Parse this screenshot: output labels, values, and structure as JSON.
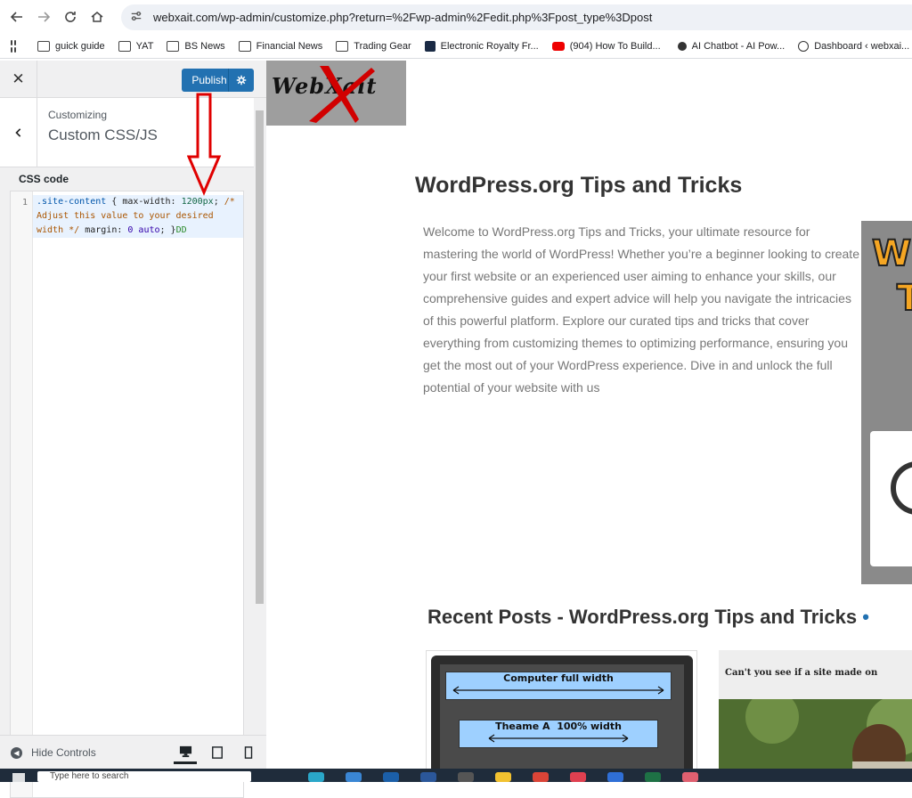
{
  "browser": {
    "url": "webxait.com/wp-admin/customize.php?return=%2Fwp-admin%2Fedit.php%3Fpost_type%3Dpost",
    "bookmarks": [
      {
        "label": "guick guide",
        "icon": "folder-icon"
      },
      {
        "label": "YAT",
        "icon": "folder-icon"
      },
      {
        "label": "BS News",
        "icon": "folder-icon"
      },
      {
        "label": "Financial News",
        "icon": "folder-icon"
      },
      {
        "label": "Trading Gear",
        "icon": "folder-icon"
      },
      {
        "label": "Electronic Royalty Fr...",
        "icon": "st-site-icon"
      },
      {
        "label": "(904) How To Build...",
        "icon": "youtube-icon"
      },
      {
        "label": "AI Chatbot - AI Pow...",
        "icon": "openai-icon"
      },
      {
        "label": "Dashboard ‹ webxai...",
        "icon": "wordpress-icon"
      }
    ]
  },
  "customizer": {
    "publish_label": "Publish",
    "customizing_label": "Customizing",
    "section_title": "Custom CSS/JS",
    "css_label": "CSS code",
    "line_number": "1",
    "code": {
      "selector": ".site-content",
      "brace_open": " { ",
      "prop1": "max-width",
      "colon": ": ",
      "value1": "1200px",
      "semi": "; ",
      "comment_start": "/*",
      "comment_body": "Adjust this value to your desired width",
      "comment_end": "*/",
      "prop2": "margin",
      "value2": "0 auto",
      "brace_close": "; }",
      "trailing": "DD"
    },
    "hide_controls_label": "Hide Controls"
  },
  "preview": {
    "logo_text": "WebXait",
    "site_title": "WordPress.org Tips and Tricks",
    "intro": "Welcome to WordPress.org Tips and Tricks, your ultimate resource for mastering the world of WordPress! Whether you’re a beginner looking to create your first website or an experienced user aiming to enhance your skills, our comprehensive guides and expert advice will help you navigate the intricacies of this powerful platform. Explore our curated tips and tricks that cover everything from customizing themes to optimizing performance, ensuring you get the most out of your WordPress experience. Dive in and unlock the full potential of your website with us",
    "recent_posts_title": "Recent Posts - WordPress.org Tips and Tricks",
    "recent_bullet": "•",
    "post1": {
      "line1": "Computer full width",
      "line2": "Theame A  100% width"
    },
    "post2": {
      "caption": "Can't you see if a site made on"
    }
  },
  "taskbar": {
    "search_placeholder": "Type here to search"
  },
  "colors": {
    "publish_blue": "#2271b1",
    "annotation_red": "#e00000"
  }
}
